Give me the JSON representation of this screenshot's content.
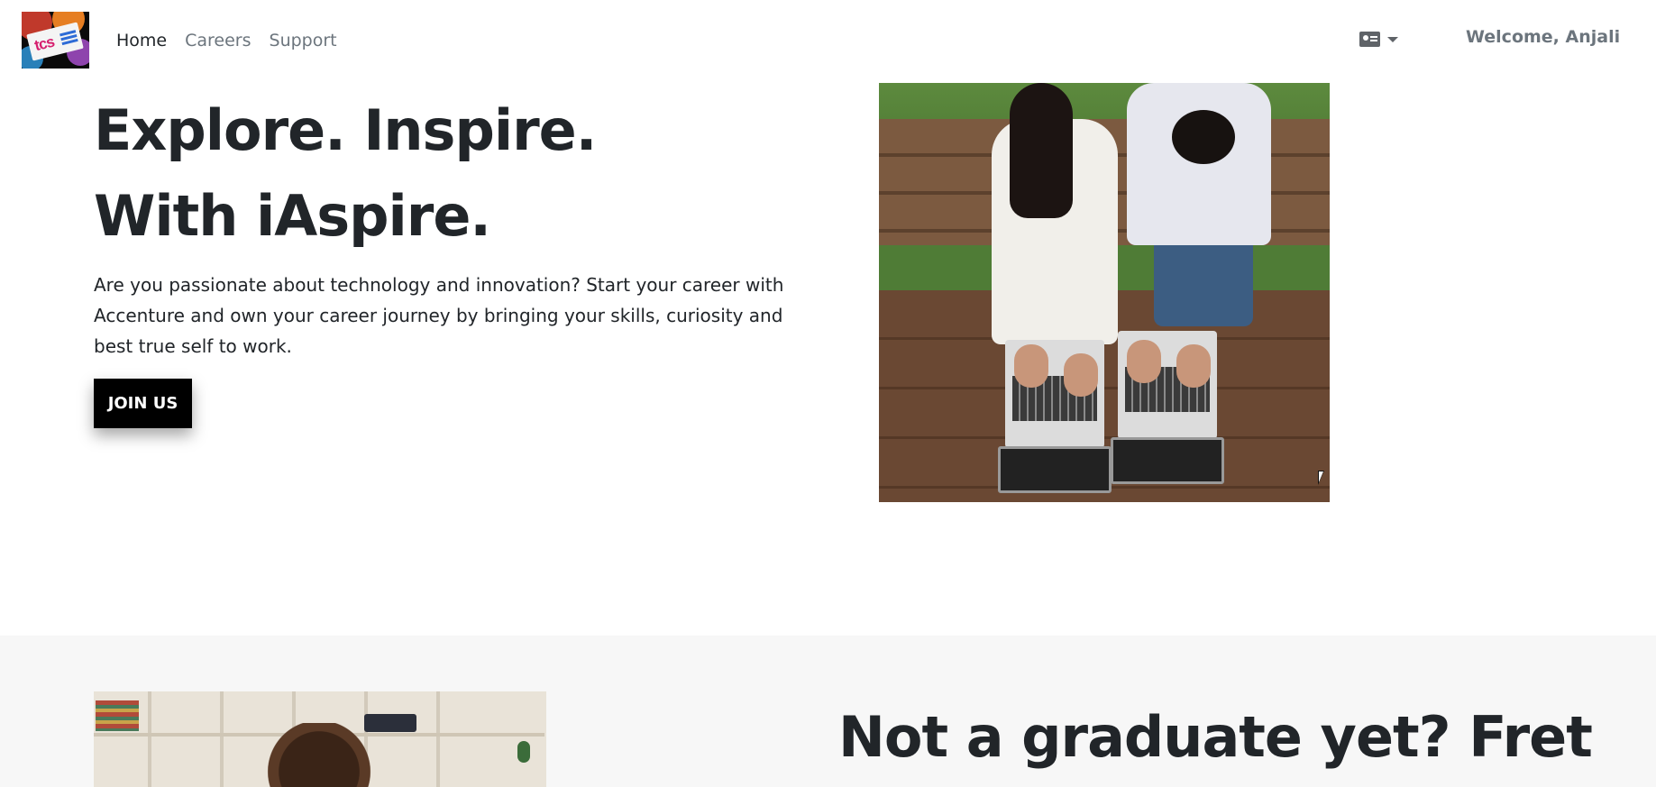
{
  "nav": {
    "logo_alt": "TCS logo",
    "links": [
      {
        "label": "Home",
        "active": true
      },
      {
        "label": "Careers",
        "active": false
      },
      {
        "label": "Support",
        "active": false
      }
    ],
    "profile_icon": "id-card-icon",
    "welcome_text": "Welcome, Anjali"
  },
  "hero": {
    "title": "Explore. Inspire. With iAspire.",
    "text": "Are you passionate about technology and innovation? Start your career with Accenture and own your career journey by bringing your skills, curiosity and best true self to work.",
    "cta_label": "JOIN US"
  },
  "section2": {
    "title": "Not a graduate yet? Fret"
  },
  "colors": {
    "text": "#212529",
    "muted": "#6c757d",
    "button_bg": "#000000",
    "section_bg": "#f7f7f7"
  }
}
